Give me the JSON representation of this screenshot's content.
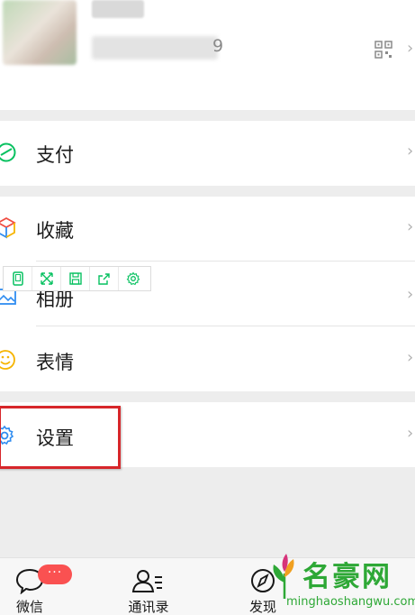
{
  "profile": {
    "id_suffix": "9",
    "qr_icon": "qrcode-icon",
    "chevron": "›"
  },
  "menu": {
    "pay": "支付",
    "favorites": "收藏",
    "album": "相册",
    "stickers": "表情",
    "settings": "设置",
    "chevron": "›"
  },
  "toolbar": {
    "icons": [
      "phone-icon",
      "expand-icon",
      "save-icon",
      "share-icon",
      "gear-icon"
    ]
  },
  "tabs": {
    "chats": "微信",
    "contacts": "通讯录",
    "discover": "发现",
    "badge": "···"
  },
  "watermark": {
    "name": "名豪网",
    "url": "minghaoshangwu.com"
  },
  "colors": {
    "accent_green": "#07c160",
    "highlight_red": "#d7262a",
    "badge_red": "#fa5151"
  }
}
